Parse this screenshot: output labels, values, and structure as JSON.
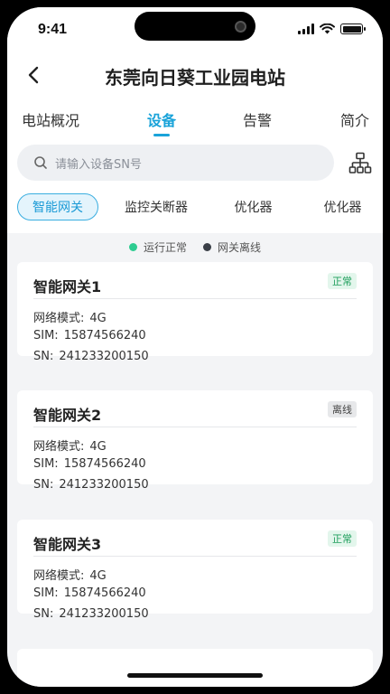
{
  "status_bar": {
    "time": "9:41"
  },
  "header": {
    "title": "东莞向日葵工业园电站"
  },
  "tabs": [
    {
      "label": "电站概况",
      "active": false
    },
    {
      "label": "设备",
      "active": true
    },
    {
      "label": "告警",
      "active": false
    },
    {
      "label": "简介",
      "active": false
    }
  ],
  "search": {
    "placeholder": "请输入设备SN号"
  },
  "filters": [
    {
      "label": "智能网关",
      "active": true
    },
    {
      "label": "监控关断器",
      "active": false
    },
    {
      "label": "优化器",
      "active": false
    },
    {
      "label": "优化器",
      "active": false
    }
  ],
  "legend": [
    {
      "label": "运行正常",
      "color": "#2ecc91"
    },
    {
      "label": "网关离线",
      "color": "#3a3f47"
    }
  ],
  "field_labels": {
    "network": "网络模式:",
    "sim": "SIM:",
    "sn": "SN:"
  },
  "devices": [
    {
      "name": "智能网关1",
      "status": "正常",
      "status_type": "ok",
      "network": "4G",
      "sim": "15874566240",
      "sn": "241233200150"
    },
    {
      "name": "智能网关2",
      "status": "离线",
      "status_type": "off",
      "network": "4G",
      "sim": "15874566240",
      "sn": "241233200150"
    },
    {
      "name": "智能网关3",
      "status": "正常",
      "status_type": "ok",
      "network": "4G",
      "sim": "15874566240",
      "sn": "241233200150"
    }
  ],
  "colors": {
    "accent": "#1aa3d9",
    "ok": "#1e9e5b"
  }
}
